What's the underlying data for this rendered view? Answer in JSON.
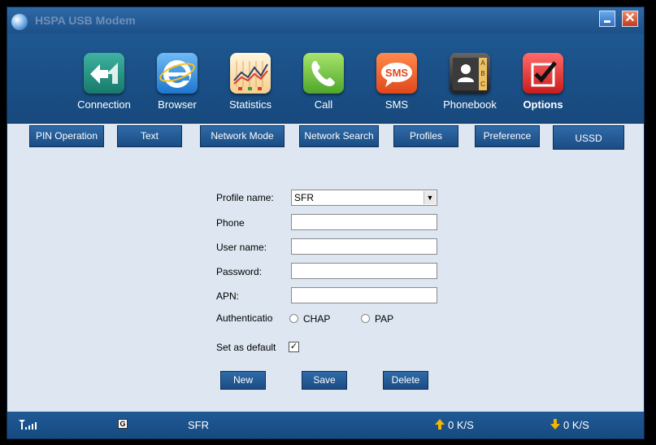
{
  "window": {
    "title": "HSPA USB Modem"
  },
  "titlebar": {
    "close_glyph": "✕"
  },
  "toolbar": {
    "items": [
      {
        "label": "Connection",
        "icon": "connection-icon"
      },
      {
        "label": "Browser",
        "icon": "browser-icon"
      },
      {
        "label": "Statistics",
        "icon": "statistics-icon"
      },
      {
        "label": "Call",
        "icon": "call-icon"
      },
      {
        "label": "SMS",
        "icon": "sms-icon"
      },
      {
        "label": "Phonebook",
        "icon": "phonebook-icon"
      },
      {
        "label": "Options",
        "icon": "options-icon"
      }
    ],
    "active": "Options",
    "sms_icon_text": "SMS",
    "phonebook_letters": [
      "A",
      "B",
      "C"
    ]
  },
  "subtabs": [
    "PIN Operation",
    "Text",
    "Network Mode",
    "Network Search",
    "Profiles",
    "Preference",
    "USSD"
  ],
  "form": {
    "profile_name_label": "Profile name:",
    "profile_name_value": "SFR",
    "phone_label": "Phone",
    "phone_value": "",
    "username_label": "User name:",
    "username_value": "",
    "password_label": "Password:",
    "password_value": "",
    "apn_label": "APN:",
    "apn_value": "",
    "auth_label": "Authenticatio",
    "auth_options": [
      "CHAP",
      "PAP"
    ],
    "default_label": "Set as default",
    "default_checked": true,
    "check_glyph": "✓",
    "buttons": {
      "new": "New",
      "save": "Save",
      "delete": "Delete"
    }
  },
  "statusbar": {
    "network_type": "G",
    "operator": "SFR",
    "upload_speed": "0 K/S",
    "download_speed": "0 K/S"
  }
}
